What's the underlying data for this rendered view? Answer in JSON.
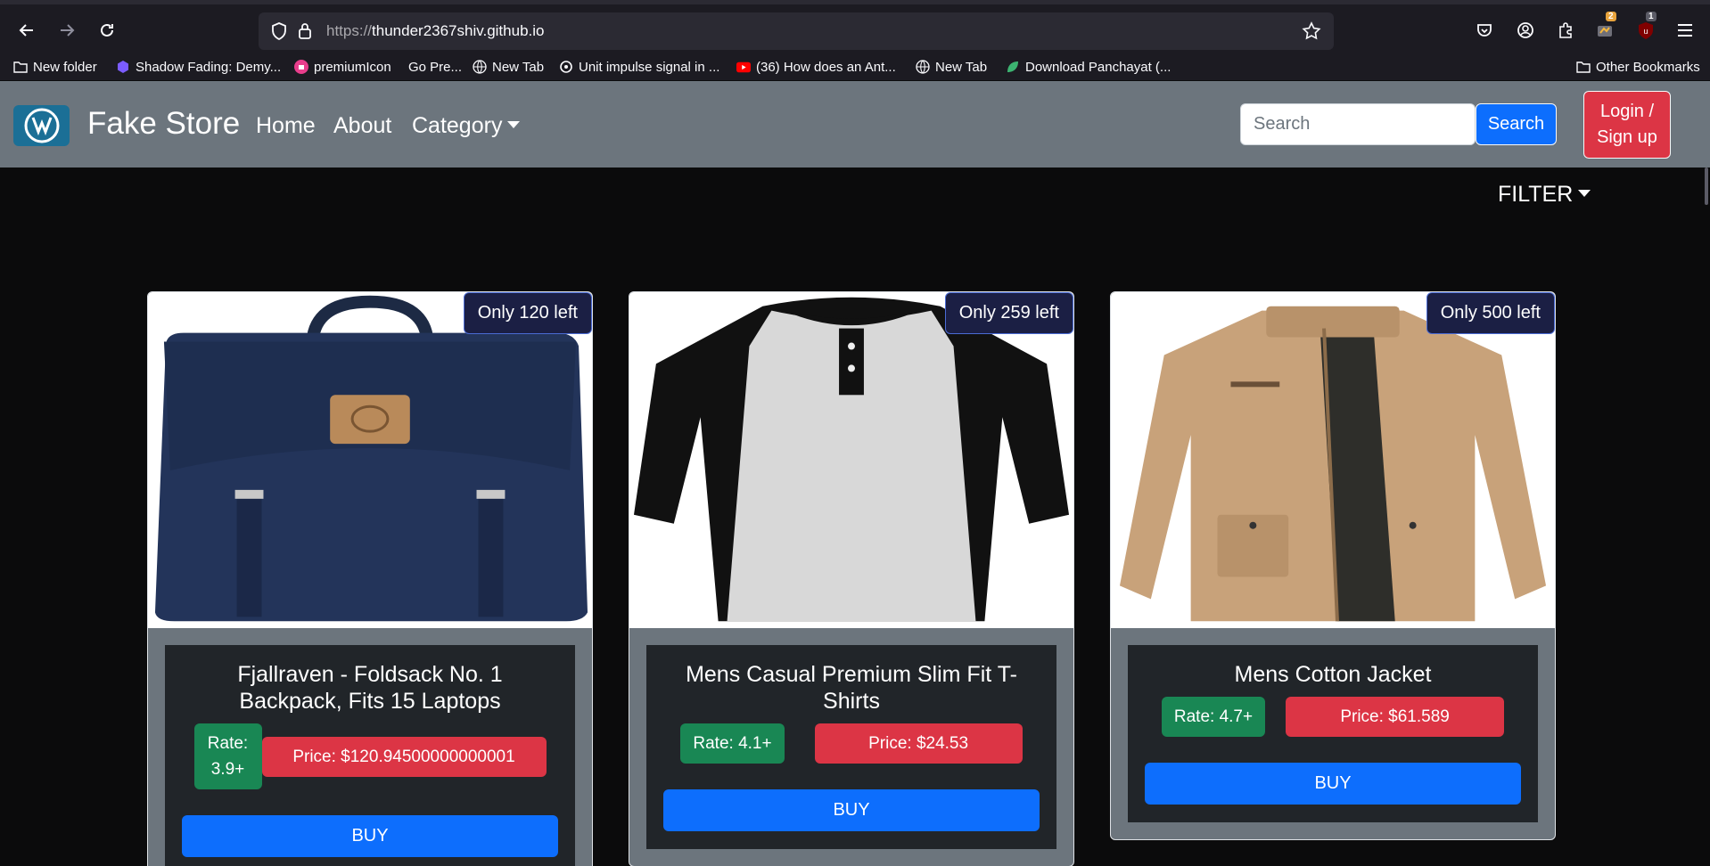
{
  "browser": {
    "url_scheme": "https://",
    "url_host": "thunder2367shiv.github.io",
    "badges": {
      "ext1": "2",
      "ext2": "1"
    },
    "bookmarks": [
      "New folder",
      "Shadow Fading: Demy...",
      "premiumIcon",
      "Go Pre...",
      "New Tab",
      "Unit impulse signal in ...",
      "(36) How does an Ant...",
      "New Tab",
      "Download Panchayat (..."
    ],
    "other_bookmarks": "Other Bookmarks"
  },
  "site": {
    "brand": "Fake Store",
    "nav": {
      "home": "Home",
      "about": "About",
      "category": "Category"
    },
    "search_placeholder": "Search",
    "search_button": "Search",
    "login_line1": "Login /",
    "login_line2": "Sign up",
    "filter": "FILTER"
  },
  "products": [
    {
      "stock": "Only 120 left",
      "title": "Fjallraven - Foldsack No. 1 Backpack, Fits 15 Laptops",
      "rate": "Rate: 3.9+",
      "price": "Price: $120.94500000000001",
      "buy": "BUY"
    },
    {
      "stock": "Only 259 left",
      "title": "Mens Casual Premium Slim Fit T-Shirts",
      "rate": "Rate: 4.1+",
      "price": "Price: $24.53",
      "buy": "BUY"
    },
    {
      "stock": "Only 500 left",
      "title": "Mens Cotton Jacket",
      "rate": "Rate: 4.7+",
      "price": "Price: $61.589",
      "buy": "BUY"
    }
  ],
  "colors": {
    "navbar": "#6c757d",
    "primary": "#0d6efd",
    "danger": "#dc3545",
    "success": "#198754",
    "background": "#0b0b0c"
  }
}
